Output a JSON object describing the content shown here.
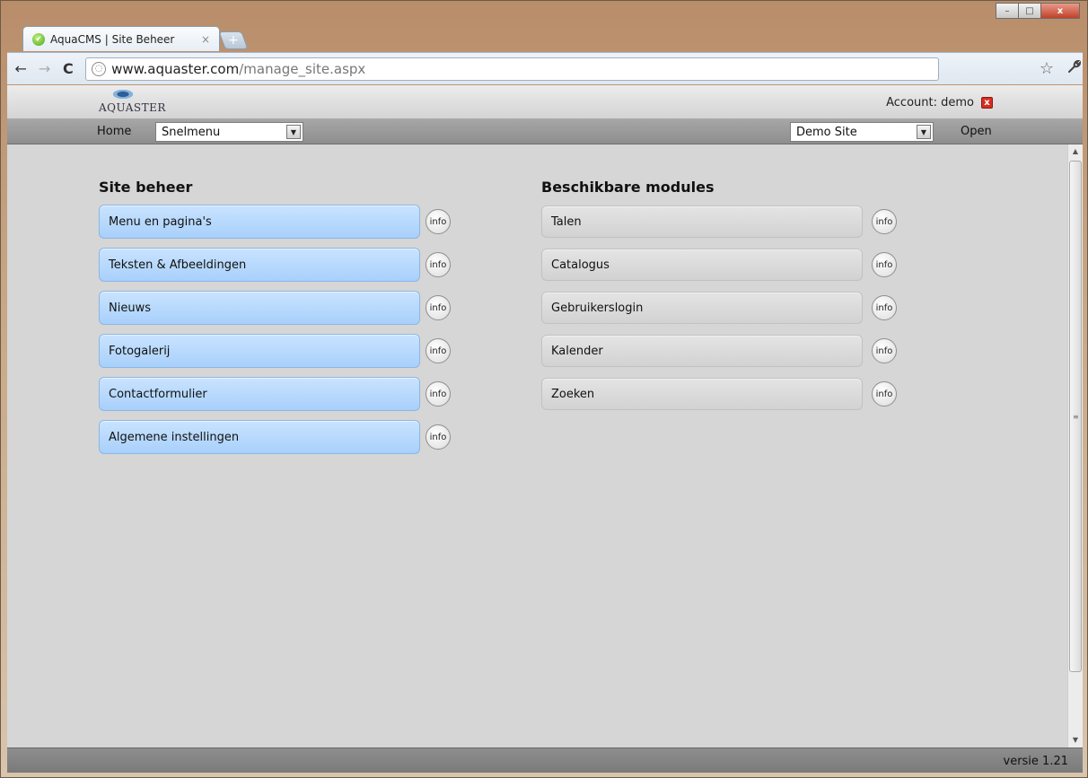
{
  "browser": {
    "tab_title": "AquaCMS | Site Beheer",
    "tab_close": "×",
    "new_tab": "+",
    "url_host": "www.aquaster.com",
    "url_path": "/manage_site.aspx",
    "back": "←",
    "forward": "→",
    "reload": "C",
    "bookmark": "☆",
    "wrench": "🔧",
    "win_minimize": "–",
    "win_maximize": "□",
    "win_close": "x"
  },
  "header": {
    "logo_text": "AQUASTER",
    "account_label": "Account: demo",
    "logout_icon": "x"
  },
  "menubar": {
    "home": "Home",
    "quick_menu": "Snelmenu",
    "site": "Demo Site",
    "open": "Open",
    "dropdown_arrow": "▼"
  },
  "site_beheer": {
    "title": "Site beheer",
    "items": [
      {
        "label": "Menu en pagina's",
        "info": "info"
      },
      {
        "label": "Teksten & Afbeeldingen",
        "info": "info"
      },
      {
        "label": "Nieuws",
        "info": "info"
      },
      {
        "label": "Fotogalerij",
        "info": "info"
      },
      {
        "label": "Contactformulier",
        "info": "info"
      },
      {
        "label": "Algemene instellingen",
        "info": "info"
      }
    ]
  },
  "modules": {
    "title": "Beschikbare modules",
    "items": [
      {
        "label": "Talen",
        "info": "info"
      },
      {
        "label": "Catalogus",
        "info": "info"
      },
      {
        "label": "Gebruikerslogin",
        "info": "info"
      },
      {
        "label": "Kalender",
        "info": "info"
      },
      {
        "label": "Zoeken",
        "info": "info"
      }
    ]
  },
  "footer": {
    "version": "versie 1.21"
  },
  "colors": {
    "blue_button": "#b6dafe",
    "grey_button": "#dcdcdc",
    "page_bg": "#d6d6d6",
    "menubar_bg": "#999999"
  }
}
